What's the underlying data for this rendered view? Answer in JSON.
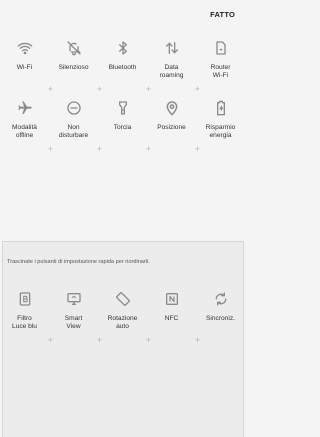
{
  "header": {
    "done_label": "FATTO"
  },
  "active_tiles": [
    {
      "label": "Wi-Fi",
      "icon": "wifi-icon"
    },
    {
      "label": "Silenzioso",
      "icon": "mute-icon"
    },
    {
      "label": "Bluetooth",
      "icon": "bluetooth-icon"
    },
    {
      "label": "Data\nroaming",
      "icon": "data-roaming-icon"
    },
    {
      "label": "Router\nWi-Fi",
      "icon": "router-icon"
    },
    {
      "label": "Modalità\noffline",
      "icon": "airplane-icon"
    },
    {
      "label": "Non\ndisturbare",
      "icon": "do-not-disturb-icon"
    },
    {
      "label": "Torcia",
      "icon": "flashlight-icon"
    },
    {
      "label": "Posizione",
      "icon": "location-icon"
    },
    {
      "label": "Risparmio\nenergia",
      "icon": "battery-saver-icon"
    }
  ],
  "available_panel": {
    "hint": "Trascinate i pulsanti di impostazione rapida per riordinarli.",
    "tiles": [
      {
        "label": "Filtro\nLuce blu",
        "icon": "blue-light-filter-icon"
      },
      {
        "label": "Smart\nView",
        "icon": "smart-view-icon"
      },
      {
        "label": "Rotazione\nauto",
        "icon": "auto-rotate-icon"
      },
      {
        "label": "NFC",
        "icon": "nfc-icon"
      },
      {
        "label": "Sincroniz.",
        "icon": "sync-icon"
      }
    ]
  },
  "colors": {
    "icon": "#8c8c8c",
    "plus": "#b8b8b8",
    "background": "#f4f4f4",
    "panel": "#ececec"
  }
}
